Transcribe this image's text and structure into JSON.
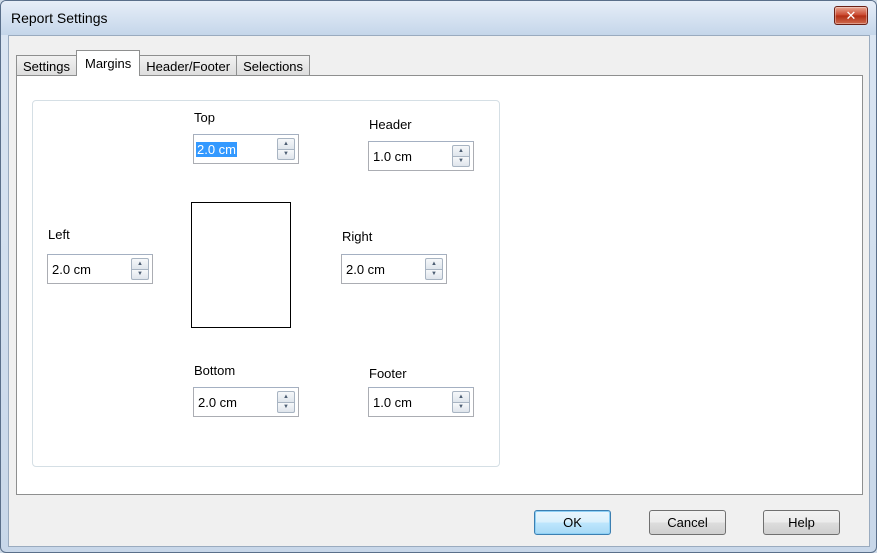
{
  "window": {
    "title": "Report Settings"
  },
  "tabs": [
    {
      "label": "Settings"
    },
    {
      "label": "Margins"
    },
    {
      "label": "Header/Footer"
    },
    {
      "label": "Selections"
    }
  ],
  "active_tab": "Margins",
  "margins": {
    "top": {
      "label": "Top",
      "value": "2.0 cm"
    },
    "header": {
      "label": "Header",
      "value": "1.0 cm"
    },
    "left": {
      "label": "Left",
      "value": "2.0 cm"
    },
    "right": {
      "label": "Right",
      "value": "2.0 cm"
    },
    "bottom": {
      "label": "Bottom",
      "value": "2.0 cm"
    },
    "footer": {
      "label": "Footer",
      "value": "1.0 cm"
    }
  },
  "buttons": {
    "ok": "OK",
    "cancel": "Cancel",
    "help": "Help"
  },
  "icons": {
    "close": "close-icon",
    "spin_up": "arrow-up-icon",
    "spin_down": "arrow-down-icon"
  },
  "colors": {
    "selection": "#3399ff",
    "default_button_border": "#3c7fb1",
    "close_button": "#c9442b"
  }
}
